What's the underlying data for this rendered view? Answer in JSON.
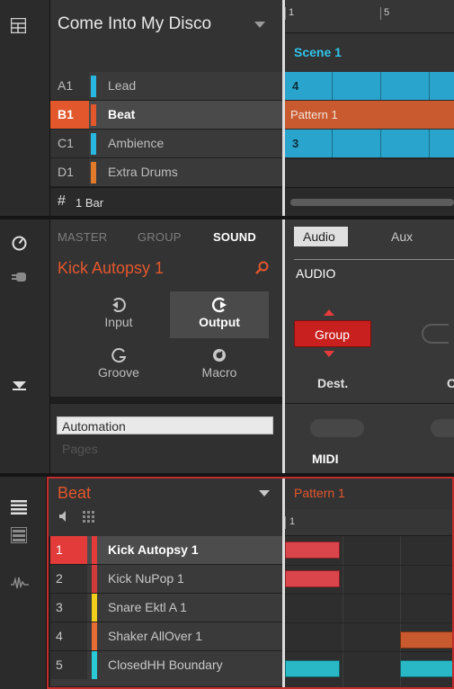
{
  "arranger": {
    "project_title": "Come Into My Disco",
    "ruler": [
      "1",
      "5"
    ],
    "scene_label": "Scene 1",
    "groups": [
      {
        "id": "A1",
        "name": "Lead",
        "color": "#29b7e2",
        "selected": false
      },
      {
        "id": "B1",
        "name": "Beat",
        "color": "#e2572c",
        "selected": true
      },
      {
        "id": "C1",
        "name": "Ambience",
        "color": "#29b7e2",
        "selected": false
      },
      {
        "id": "D1",
        "name": "Extra Drums",
        "color": "#e27a2c",
        "selected": false
      }
    ],
    "clip_labels": {
      "lead": "4",
      "beat": "Pattern 1",
      "ambience": "3"
    },
    "footer_icon": "#",
    "length_label": "1 Bar"
  },
  "control": {
    "tabs": {
      "master": "MASTER",
      "group": "GROUP",
      "sound": "SOUND",
      "active": "SOUND"
    },
    "sound_name": "Kick Autopsy 1",
    "page_buttons": [
      {
        "label": "Input",
        "icon": "input-icon",
        "selected": false
      },
      {
        "label": "Output",
        "icon": "output-icon",
        "selected": true
      },
      {
        "label": "Groove",
        "icon": "groove-icon",
        "selected": false
      },
      {
        "label": "Macro",
        "icon": "macro-icon",
        "selected": false
      }
    ],
    "param_tabs": {
      "audio": "Audio",
      "aux": "Aux"
    },
    "section_label": "AUDIO",
    "dest_value": "Group",
    "dest_label": "Dest.",
    "automation_label": "Automation",
    "pages_label": "Pages",
    "midi_label": "MIDI"
  },
  "pattern_editor": {
    "group_name": "Beat",
    "pattern_name": "Pattern 1",
    "ruler": "1",
    "sounds": [
      {
        "num": "1",
        "name": "Kick Autopsy 1",
        "color": "#e33a3a",
        "selected": true
      },
      {
        "num": "2",
        "name": "Kick NuPop 1",
        "color": "#d03a3a",
        "selected": false
      },
      {
        "num": "3",
        "name": "Snare Ektl A 1",
        "color": "#f1cd1c",
        "selected": false
      },
      {
        "num": "4",
        "name": "Shaker AllOver 1",
        "color": "#e86d35",
        "selected": false
      },
      {
        "num": "5",
        "name": "ClosedHH Boundary",
        "color": "#29c9d6",
        "selected": false
      }
    ]
  },
  "colors": {
    "accent": "#e2572c",
    "cyan": "#29b7e2",
    "selection_frame": "#c42b2b",
    "label_cyan": "#31c3e8"
  }
}
